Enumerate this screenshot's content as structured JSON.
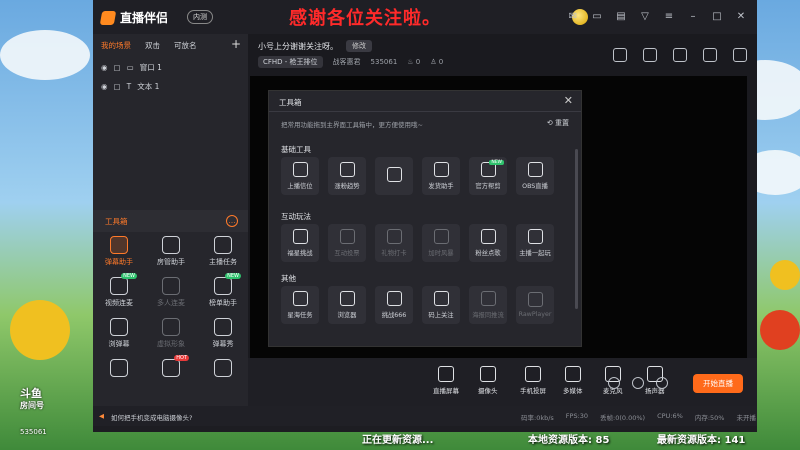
{
  "app": {
    "name": "直播伴侣",
    "version_label": "内测"
  },
  "marquee": "感谢各位关注啦。",
  "left_tabs": [
    "我的场景",
    "双击",
    "可放名"
  ],
  "scenes": [
    {
      "label": "窗口 1"
    },
    {
      "label": "文本 1"
    }
  ],
  "toolbox_title": "工具箱",
  "left_tools": [
    {
      "label": "弹幕助手",
      "active": true,
      "badge": ""
    },
    {
      "label": "房管助手",
      "badge": ""
    },
    {
      "label": "主播任务",
      "badge": ""
    },
    {
      "label": "视频连麦",
      "badge": "NEW"
    },
    {
      "label": "多人连麦",
      "dim": true,
      "badge": ""
    },
    {
      "label": "榜单助手",
      "badge": "NEW"
    },
    {
      "label": "浏弹幕",
      "badge": ""
    },
    {
      "label": "虚拟形象",
      "dim": true,
      "badge": ""
    },
    {
      "label": "弹幕秀",
      "badge": ""
    },
    {
      "label": "",
      "badge": ""
    },
    {
      "label": "",
      "badge": "HOT"
    },
    {
      "label": "",
      "badge": ""
    }
  ],
  "room": {
    "title": "小号上分谢谢关注呀。",
    "edit": "修改",
    "category": "CFHD - 枪王排位",
    "streamer": "战客惠君",
    "room_id": "535061",
    "likes": "0",
    "viewers": "0"
  },
  "panel": {
    "title": "工具箱",
    "tip": "把常用功能拖到主界面工具箱中，更方便使用哦~",
    "reset": "重置",
    "sections": [
      {
        "title": "基础工具",
        "tools": [
          {
            "label": "上播信位"
          },
          {
            "label": "涨粉趋势"
          },
          {
            "label": ""
          },
          {
            "label": "发货助手"
          },
          {
            "label": "官方帮剪",
            "new": "NEW"
          },
          {
            "label": "OBS直播"
          }
        ]
      },
      {
        "title": "互动玩法",
        "tools": [
          {
            "label": "福星挑战"
          },
          {
            "label": "互动投票",
            "dim": true
          },
          {
            "label": "礼物打卡",
            "dim": true
          },
          {
            "label": "加时风暴",
            "dim": true
          },
          {
            "label": "粉丝点歌"
          },
          {
            "label": "主播一起玩"
          }
        ]
      },
      {
        "title": "其他",
        "tools": [
          {
            "label": "星海任务"
          },
          {
            "label": "浏览器"
          },
          {
            "label": "挑战666"
          },
          {
            "label": "码上关注"
          },
          {
            "label": "海报同推流",
            "dim": true
          },
          {
            "label": "RawPlayer",
            "dim": true
          }
        ]
      }
    ]
  },
  "bottom_tools": [
    {
      "label": "直播屏幕"
    },
    {
      "label": "摄像头"
    },
    {
      "label": "手机投屏"
    },
    {
      "label": "多媒体"
    },
    {
      "label": "麦克风"
    },
    {
      "label": "扬声器"
    }
  ],
  "start_button": "开始直播",
  "status": {
    "question": "如何把手机变成电脑摄像头?",
    "bitrate": "码率:0kb/s",
    "fps": "FPS:30",
    "drop": "丢帧:0(0.00%)",
    "cpu": "CPU:6%",
    "mem": "内存:50%",
    "state": "未开播"
  },
  "overlay": {
    "watermark_line1": "斗鱼",
    "watermark_line2": "房间号",
    "watermark_id": "535061",
    "updating": "正在更新资源...",
    "local_ver": "本地资源版本: 85",
    "latest_ver": "最新资源版本: 141"
  }
}
